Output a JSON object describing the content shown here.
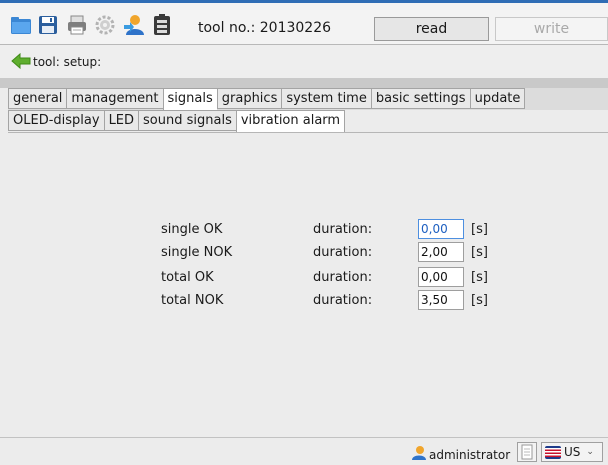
{
  "toolbar": {
    "tool_no_label": "tool no.: 20130226",
    "read_label": "read",
    "write_label": "write",
    "icons": [
      "folder-icon",
      "save-icon",
      "print-icon",
      "gear-icon",
      "user-transfer-icon",
      "battery-icon"
    ]
  },
  "tool_row": {
    "label": "tool: setup:",
    "back_icon": "green-left-arrow-icon"
  },
  "tabs": [
    {
      "label": "general",
      "active": false
    },
    {
      "label": "management",
      "active": false
    },
    {
      "label": "signals",
      "active": true
    },
    {
      "label": "graphics",
      "active": false
    },
    {
      "label": "system time",
      "active": false
    },
    {
      "label": "basic settings",
      "active": false
    },
    {
      "label": "update",
      "active": false
    }
  ],
  "subtabs": [
    {
      "label": "OLED-display",
      "active": false
    },
    {
      "label": "LED",
      "active": false
    },
    {
      "label": "sound signals",
      "active": false
    },
    {
      "label": "vibration alarm",
      "active": true
    }
  ],
  "settings": [
    {
      "label": "single OK",
      "duration_label": "duration:",
      "value": "0,00",
      "unit": "[s]"
    },
    {
      "label": "single NOK",
      "duration_label": "duration:",
      "value": "2,00",
      "unit": "[s]"
    },
    {
      "label": "total OK",
      "duration_label": "duration:",
      "value": "0,00",
      "unit": "[s]"
    },
    {
      "label": "total NOK",
      "duration_label": "duration:",
      "value": "3,50",
      "unit": "[s]"
    }
  ],
  "status": {
    "user": "administrator",
    "language": "US"
  },
  "colors": {
    "accent": "#2f6db5",
    "focus_text": "#1d5fc0",
    "disabled_text": "#a9a9a9"
  }
}
